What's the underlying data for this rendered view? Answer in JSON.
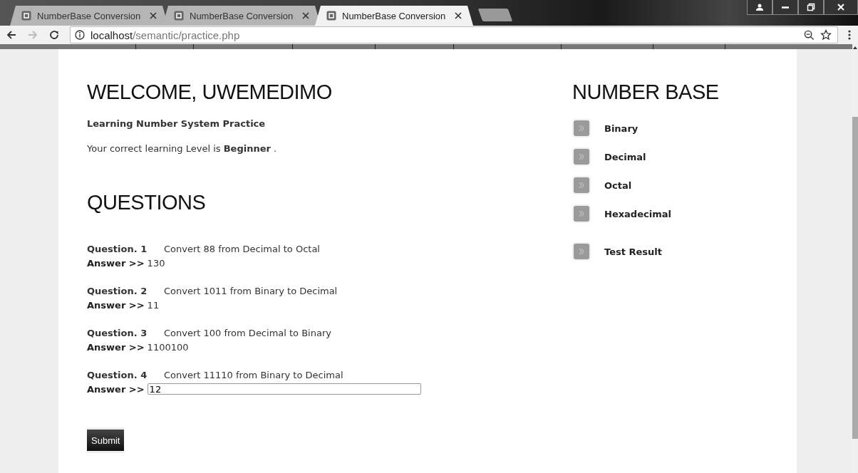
{
  "browser": {
    "tabs": [
      {
        "title": "NumberBase Conversion",
        "selected": false
      },
      {
        "title": "NumberBase Conversion",
        "selected": false
      },
      {
        "title": "NumberBase Conversion",
        "selected": true
      }
    ],
    "address": {
      "host": "localhost",
      "path": "/semantic/practice.php"
    }
  },
  "page": {
    "welcome": "WELCOME, UWEMEDIMO",
    "subtitle": "Learning Number System Practice",
    "level_text": "Your correct learning Level is **Beginner** .",
    "questions_heading": "QUESTIONS",
    "questions": [
      {
        "label": "Question. 1",
        "text": "Convert 88 from Decimal to Octal",
        "answer_label": "Answer >>",
        "kind": "text",
        "answer": "130"
      },
      {
        "label": "Question. 2",
        "text": "Convert 1011 from Binary to Decimal",
        "answer_label": "Answer >>",
        "kind": "text",
        "answer": "11"
      },
      {
        "label": "Question. 3",
        "text": "Convert 100 from Decimal to Binary",
        "answer_label": "Answer >>",
        "kind": "text",
        "answer": "1100100"
      },
      {
        "label": "Question. 4",
        "text": "Convert 11110 from Binary to Decimal",
        "answer_label": "Answer >>",
        "kind": "input",
        "answer": "12"
      }
    ],
    "submit": "Submit"
  },
  "sidebar": {
    "title": "NUMBER BASE",
    "items": [
      {
        "label": "Binary"
      },
      {
        "label": "Decimal"
      },
      {
        "label": "Octal"
      },
      {
        "label": "Hexadecimal"
      }
    ],
    "result_link": "Test Result"
  }
}
